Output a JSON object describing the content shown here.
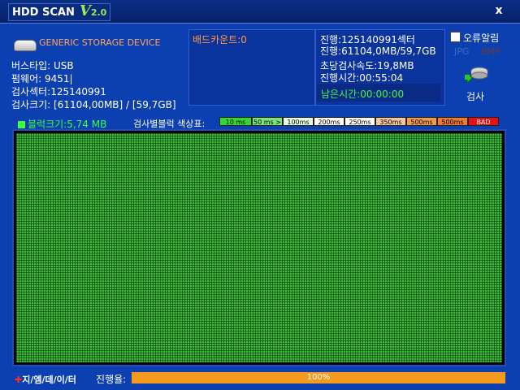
{
  "titlebar": {
    "title": "HDD SCAN",
    "v": "V",
    "version": "2.0",
    "close": "x"
  },
  "device": {
    "name": "GENERIC STORAGE DEVICE",
    "lines": [
      "버스타입: USB",
      "펌웨어: 9451|",
      "검사섹터:125140991",
      "검사크기: [61104,00MB] / [59,7GB]"
    ]
  },
  "bad": {
    "label": "배드카운트:0"
  },
  "stats": {
    "progress_sector": "진행:125140991섹터",
    "progress_size": "진행:61104,0MB/59,7GB",
    "speed": "초당검사속도:19,8MB",
    "elapsed": "진행시간:00:55:04",
    "remain": "남은시간:00:00:00"
  },
  "options": {
    "error_alert": "오류알림",
    "jpg": "JPG",
    "bmp": "BMP",
    "scan": "검사"
  },
  "legend": {
    "blocksize": "블럭크기:5,74 MB",
    "label": "검사별블럭 색상표:",
    "items": [
      {
        "label": "10 ms",
        "color": "#33d633"
      },
      {
        "label": "50 ms >",
        "color": "#7de37d"
      },
      {
        "label": "100ms >",
        "color": "#e6ffe6"
      },
      {
        "label": "200ms >",
        "color": "#ffffff"
      },
      {
        "label": "250ms >",
        "color": "#ffffff"
      },
      {
        "label": "350ms >",
        "color": "#f4c79c"
      },
      {
        "label": "500ms >",
        "color": "#f29c4a"
      },
      {
        "label": "500ms <",
        "color": "#f07a2a"
      },
      {
        "label": "BAD",
        "color": "#e81010"
      }
    ]
  },
  "footer": {
    "brand": "지/엠/데/이/터",
    "progress_label": "진행율:",
    "progress_percent": 100,
    "progress_text": "100%"
  },
  "colors": {
    "background": "#0c3fb0",
    "block_ok": "#3bbd3a",
    "accent_orange": "#f39a1f"
  }
}
